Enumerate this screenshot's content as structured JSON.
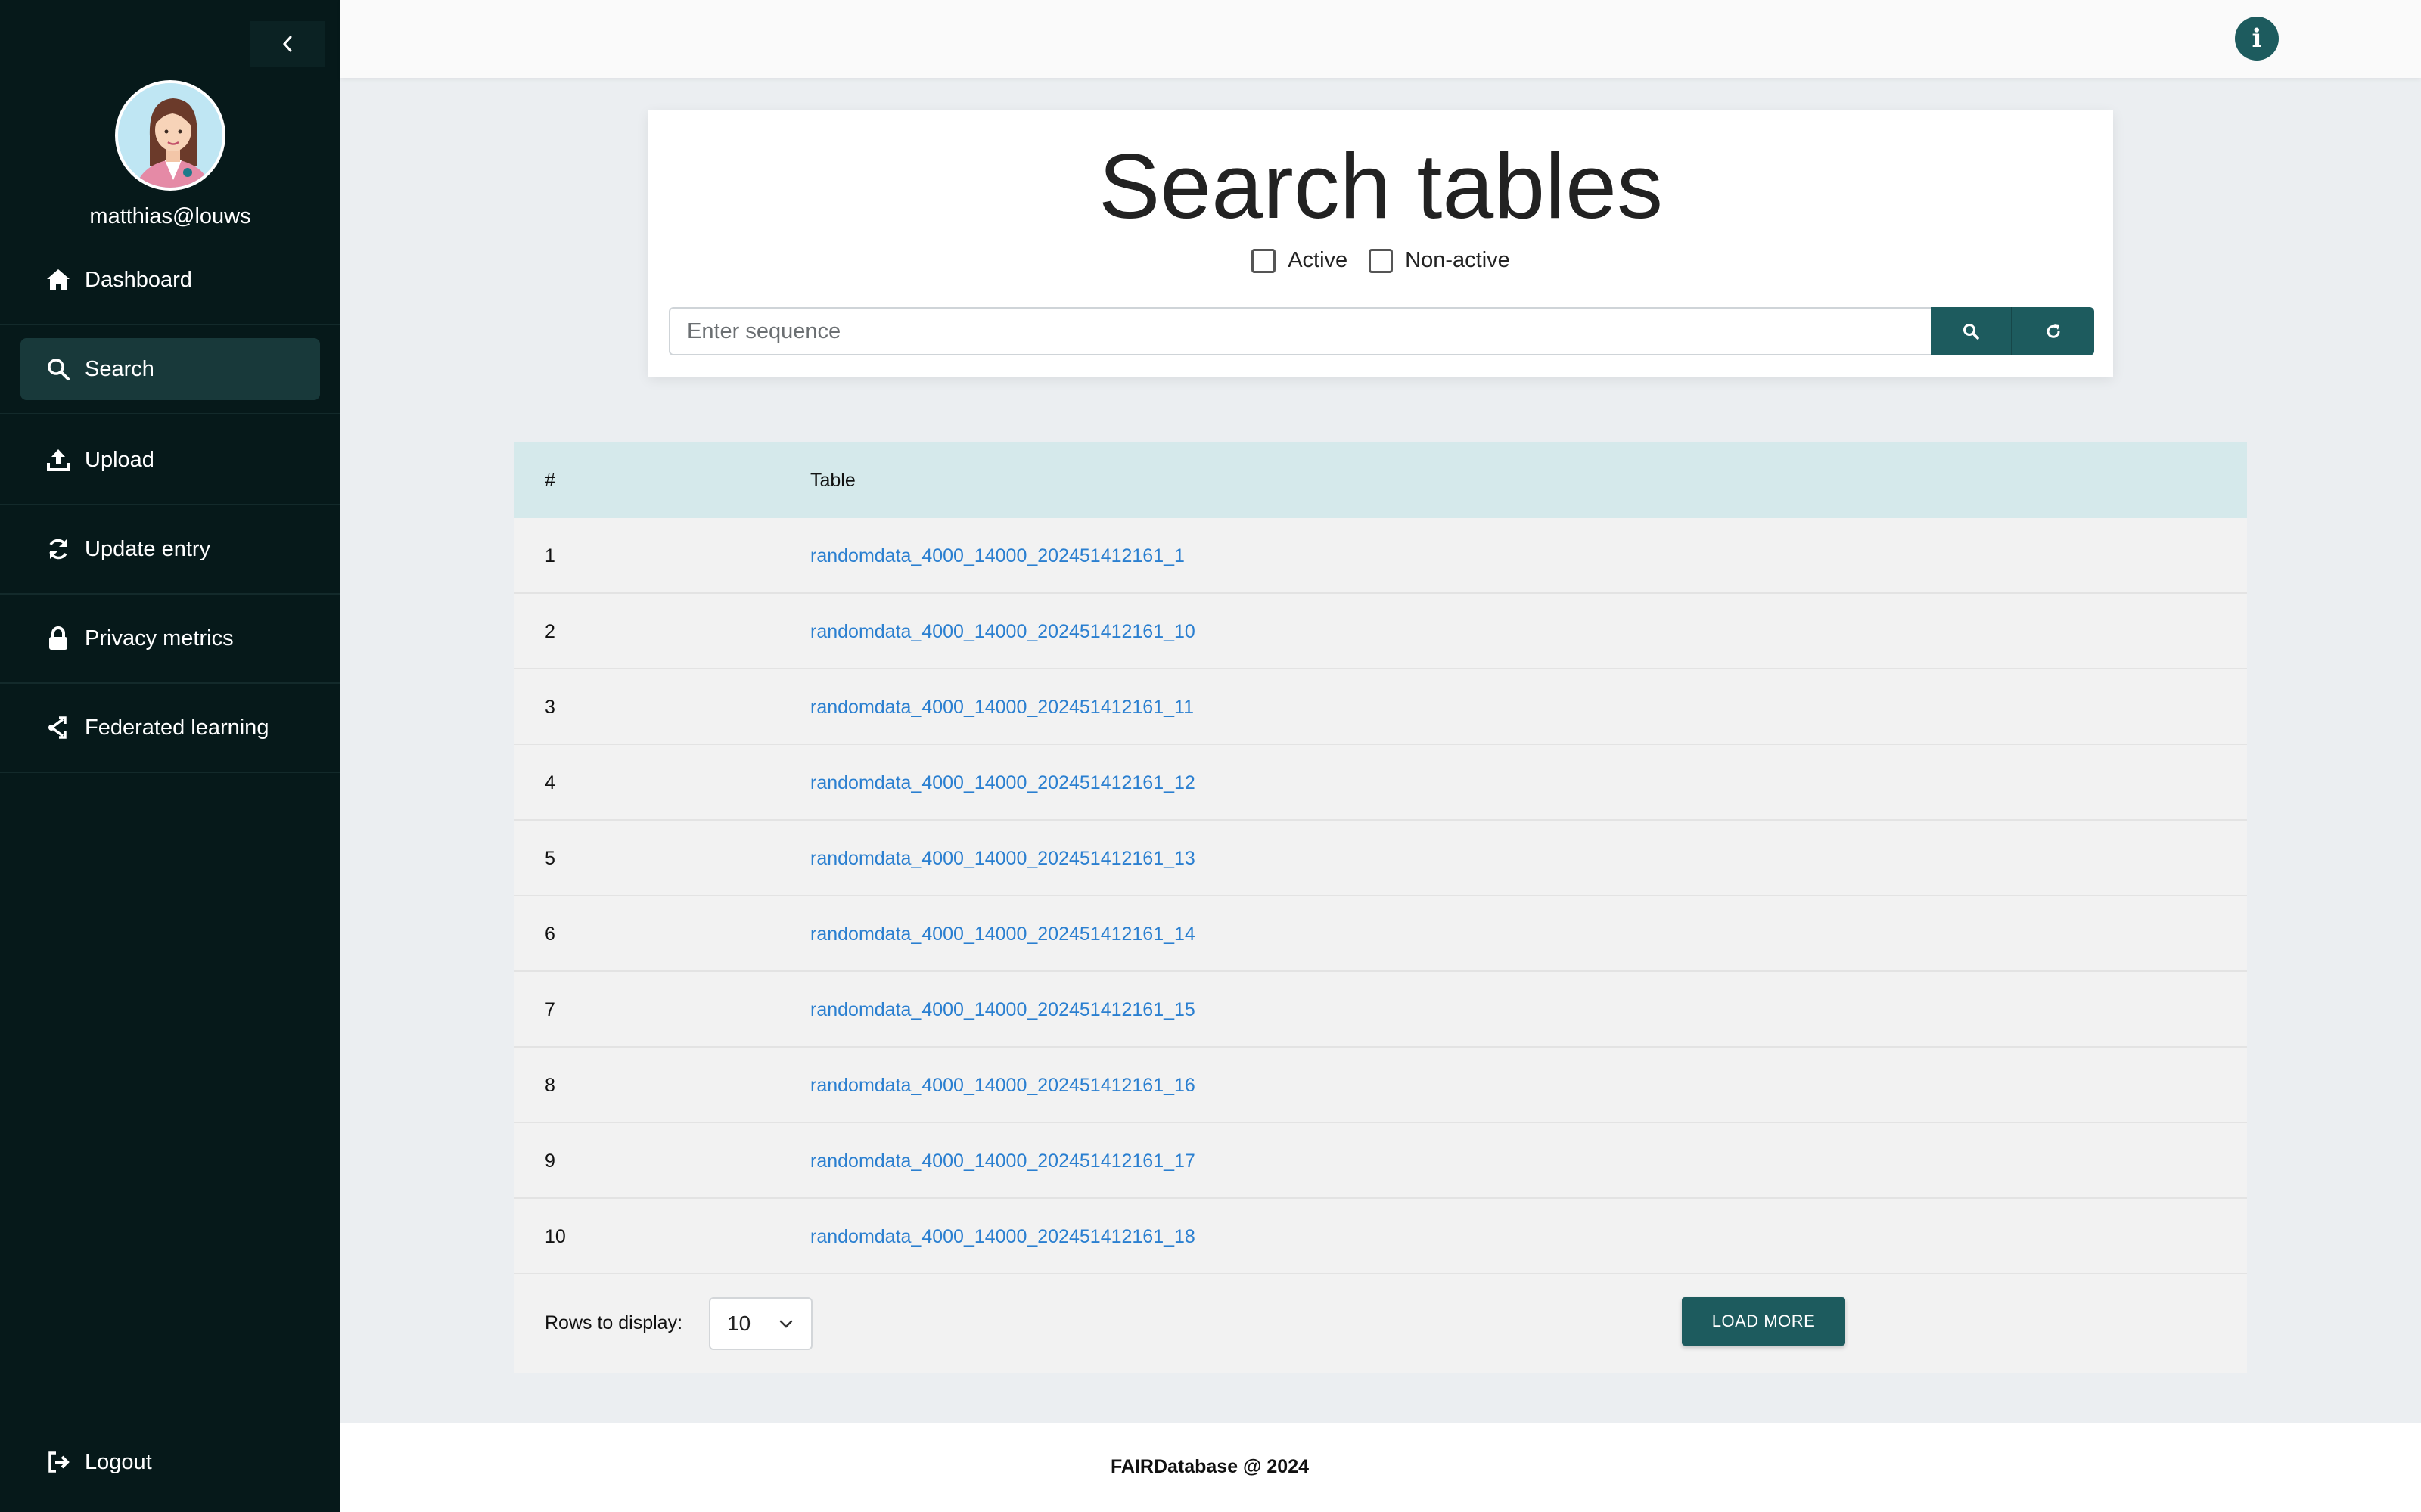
{
  "sidebar": {
    "username": "matthias@louws",
    "items": [
      {
        "label": "Dashboard",
        "icon": "home-icon",
        "active": false
      },
      {
        "label": "Search",
        "icon": "search-icon",
        "active": true
      },
      {
        "label": "Upload",
        "icon": "upload-icon",
        "active": false
      },
      {
        "label": "Update entry",
        "icon": "refresh-icon",
        "active": false
      },
      {
        "label": "Privacy metrics",
        "icon": "lock-icon",
        "active": false
      },
      {
        "label": "Federated learning",
        "icon": "federated-icon",
        "active": false
      }
    ],
    "logout_label": "Logout"
  },
  "topbar": {
    "info_icon": "info-icon",
    "info_glyph": "i"
  },
  "search": {
    "title": "Search tables",
    "filter_active": "Active",
    "filter_nonactive": "Non-active",
    "placeholder": "Enter sequence",
    "value": ""
  },
  "table": {
    "headers": [
      "#",
      "Table"
    ],
    "rows": [
      {
        "num": "1",
        "name": "randomdata_4000_14000_202451412161_1"
      },
      {
        "num": "2",
        "name": "randomdata_4000_14000_202451412161_10"
      },
      {
        "num": "3",
        "name": "randomdata_4000_14000_202451412161_11"
      },
      {
        "num": "4",
        "name": "randomdata_4000_14000_202451412161_12"
      },
      {
        "num": "5",
        "name": "randomdata_4000_14000_202451412161_13"
      },
      {
        "num": "6",
        "name": "randomdata_4000_14000_202451412161_14"
      },
      {
        "num": "7",
        "name": "randomdata_4000_14000_202451412161_15"
      },
      {
        "num": "8",
        "name": "randomdata_4000_14000_202451412161_16"
      },
      {
        "num": "9",
        "name": "randomdata_4000_14000_202451412161_17"
      },
      {
        "num": "10",
        "name": "randomdata_4000_14000_202451412161_18"
      }
    ],
    "rows_label": "Rows to display:",
    "rows_value": "10",
    "load_more": "LOAD MORE"
  },
  "footer": {
    "text": "FAIRDatabase @ 2024"
  },
  "colors": {
    "sidebar_bg": "#06191a",
    "accent": "#1d5b5e",
    "link": "#2a7fd0",
    "table_header": "#d5e9eb"
  }
}
